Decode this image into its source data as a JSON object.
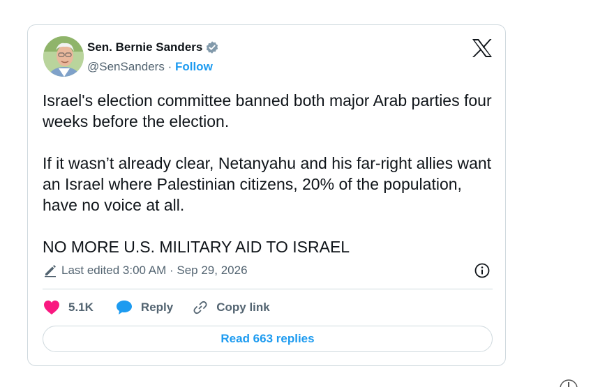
{
  "post": {
    "author": {
      "name": "Sen. Bernie Sanders",
      "handle": "@SenSanders",
      "separator": "·",
      "follow_label": "Follow",
      "verified": true
    },
    "body": {
      "paragraph_1": "Israel's election committee banned both major Arab parties four weeks before the election.",
      "paragraph_2": "If it wasn’t already clear, Netanyahu and his far-right allies want an Israel where Palestinian citizens, 20% of the population, have no voice at all.",
      "paragraph_3": "NO MORE U.S. MILITARY AID TO ISRAEL"
    },
    "meta": {
      "edited_label": "Last edited 3:00 AM · Sep 29, 2026"
    },
    "actions": {
      "like_count": "5.1K",
      "reply_label": "Reply",
      "copy_link_label": "Copy link"
    },
    "read_replies_label": "Read 663 replies"
  },
  "icons": {
    "brand": "x-logo-icon",
    "verified": "verified-badge-icon",
    "edit": "pencil-icon",
    "info": "info-icon",
    "like": "heart-icon",
    "reply": "speech-bubble-icon",
    "copy_link": "link-icon"
  },
  "colors": {
    "accent": "#1d9bf0",
    "like": "#f91880",
    "text": "#0f1419",
    "muted": "#536471",
    "border": "#cfd9de"
  }
}
